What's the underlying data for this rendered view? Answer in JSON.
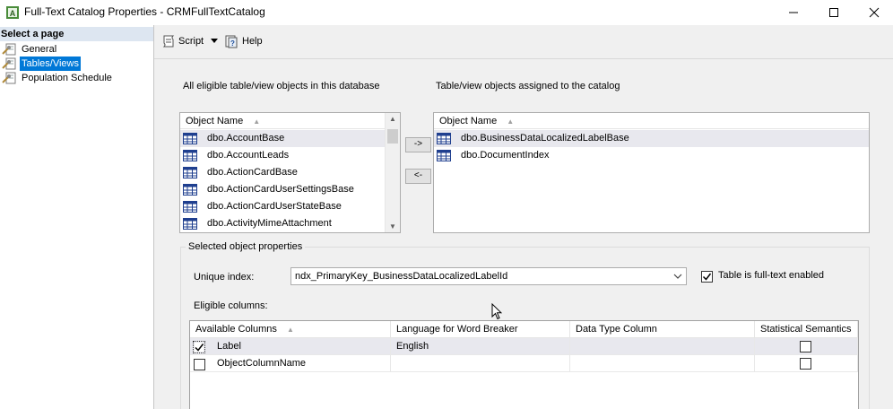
{
  "window": {
    "title": "Full-Text Catalog Properties - CRMFullTextCatalog",
    "minimize_glyph": "—",
    "maximize_glyph": "☐",
    "close_glyph": "✕"
  },
  "left": {
    "header": "Select a page",
    "pages": [
      {
        "label": "General",
        "icon": "wrench-page-icon"
      },
      {
        "label": "Tables/Views",
        "icon": "wrench-page-icon"
      },
      {
        "label": "Population Schedule",
        "icon": "wrench-page-icon"
      }
    ]
  },
  "toolbar": {
    "script_label": "Script",
    "help_label": "Help"
  },
  "eligible": {
    "caption": "All eligible table/view objects in this database",
    "header": "Object Name",
    "items": [
      "dbo.AccountBase",
      "dbo.AccountLeads",
      "dbo.ActionCardBase",
      "dbo.ActionCardUserSettingsBase",
      "dbo.ActionCardUserStateBase",
      "dbo.ActivityMimeAttachment"
    ]
  },
  "assigned": {
    "caption": "Table/view objects assigned to the catalog",
    "header": "Object Name",
    "items": [
      "dbo.BusinessDataLocalizedLabelBase",
      "dbo.DocumentIndex"
    ]
  },
  "buttons": {
    "add": "->",
    "remove": "<-"
  },
  "properties": {
    "group_title": "Selected object properties",
    "unique_index_label": "Unique index:",
    "unique_index_value": "ndx_PrimaryKey_BusinessDataLocalizedLabelId",
    "fulltext_enabled_label": "Table is full-text enabled",
    "fulltext_enabled": true,
    "eligible_columns_label": "Eligible columns:"
  },
  "columns_grid": {
    "headers": [
      "Available Columns",
      "Language for Word Breaker",
      "Data Type Column",
      "Statistical Semantics"
    ],
    "rows": [
      {
        "checked": true,
        "name": "Label",
        "language": "English",
        "data_type": "",
        "semantics": false
      },
      {
        "checked": false,
        "name": "ObjectColumnName",
        "language": "",
        "data_type": "",
        "semantics": false
      }
    ]
  },
  "icons": {
    "sort_glyph": "▲",
    "scroll_up": "▲",
    "scroll_down": "▼",
    "combo_arrow": "⌵",
    "check_glyph": "✓"
  }
}
